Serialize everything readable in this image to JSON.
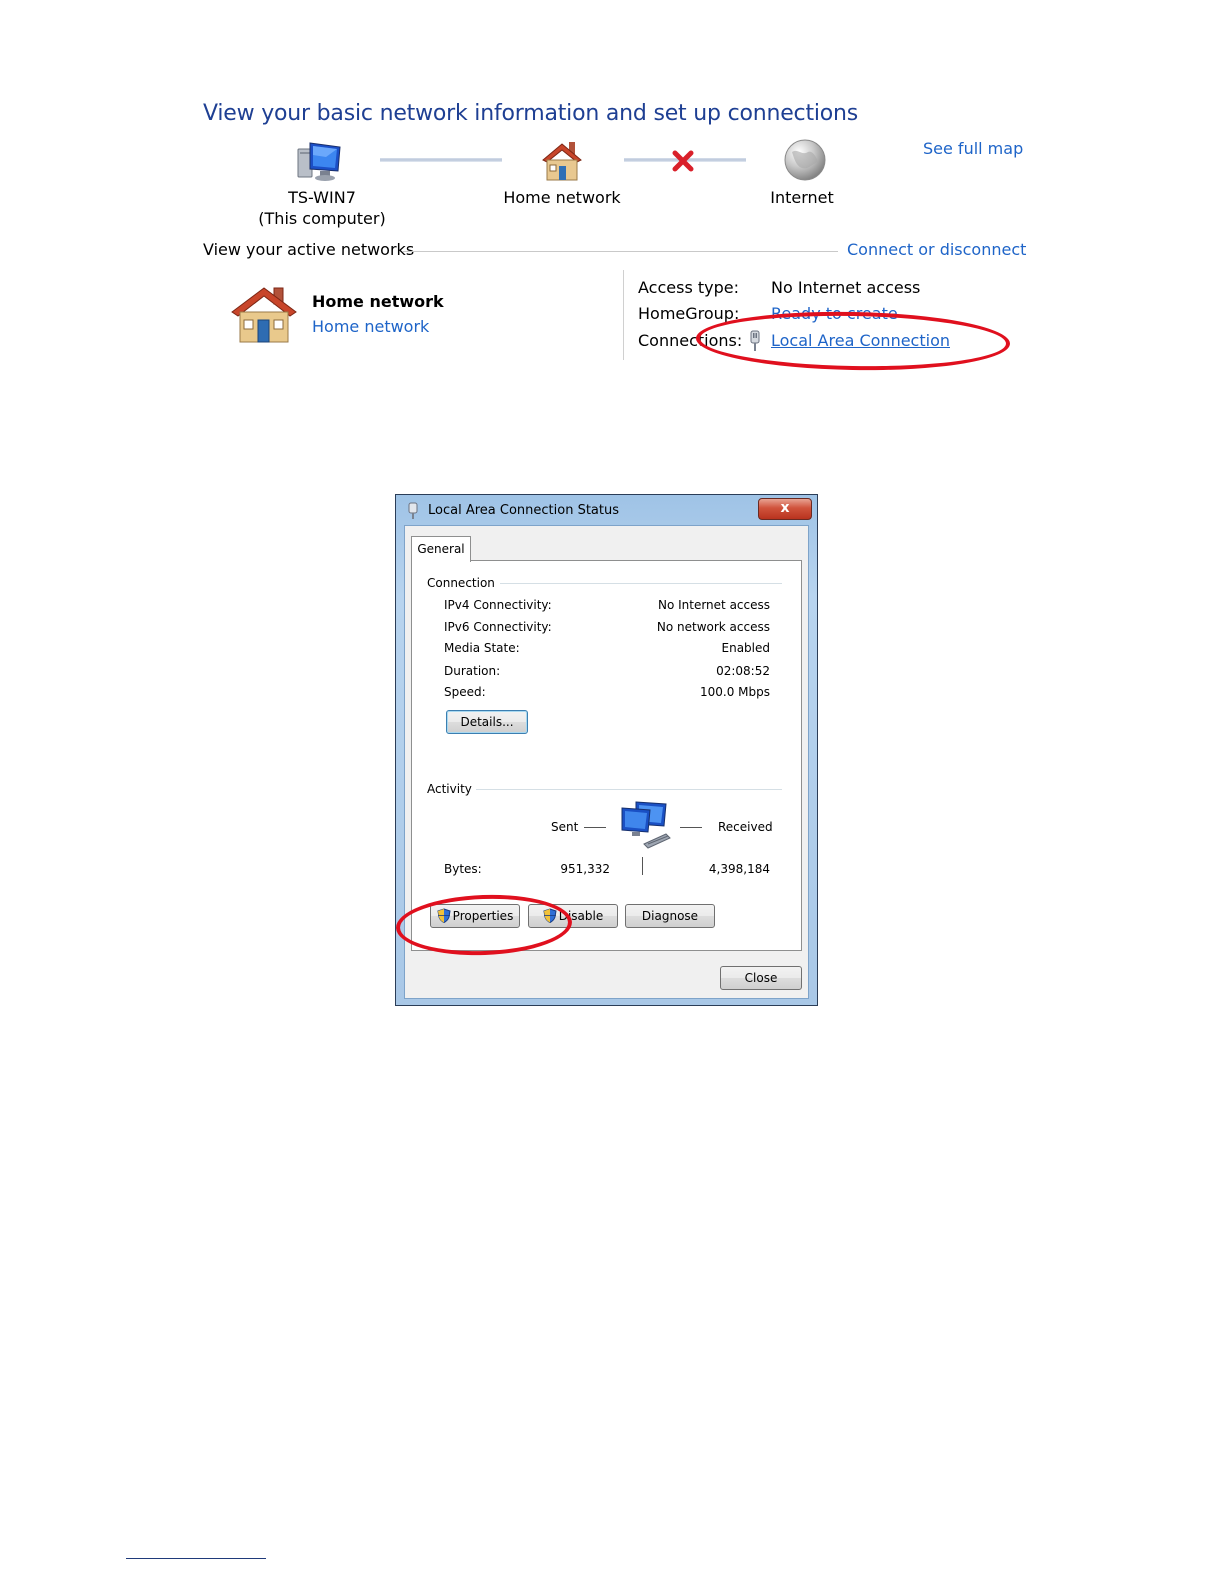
{
  "network_center": {
    "title": "View your basic network information and set up connections",
    "see_full_map": "See full map",
    "nodes": [
      {
        "label": "TS-WIN7",
        "sublabel": "(This computer)",
        "icon": "computer-icon"
      },
      {
        "label": "Home network",
        "icon": "house-icon"
      },
      {
        "label": "Internet",
        "icon": "globe-icon"
      }
    ],
    "active_networks_heading": "View your active networks",
    "connect_or_disconnect": "Connect or disconnect",
    "active_network": {
      "name": "Home network",
      "type": "Home network",
      "access_type_label": "Access type:",
      "access_type_value": "No Internet access",
      "homegroup_label": "HomeGroup:",
      "homegroup_value": "Ready to create",
      "connections_label": "Connections:",
      "connections_value": "Local Area Connection"
    }
  },
  "status_dialog": {
    "title": "Local Area Connection Status",
    "close_glyph": "x",
    "tab": "General",
    "connection_group": "Connection",
    "rows": [
      {
        "label": "IPv4 Connectivity:",
        "value": "No Internet access"
      },
      {
        "label": "IPv6 Connectivity:",
        "value": "No network access"
      },
      {
        "label": "Media State:",
        "value": "Enabled"
      },
      {
        "label": "Duration:",
        "value": "02:08:52"
      },
      {
        "label": "Speed:",
        "value": "100.0 Mbps"
      }
    ],
    "details_button": "Details...",
    "activity_group": "Activity",
    "sent_label": "Sent",
    "received_label": "Received",
    "bytes_label": "Bytes:",
    "bytes_sent": "951,332",
    "bytes_received": "4,398,184",
    "properties_button": "Properties",
    "disable_button": "Disable",
    "diagnose_button": "Diagnose",
    "close_button": "Close"
  },
  "colors": {
    "title_blue": "#1e3f93",
    "link_blue": "#1e64c8",
    "annotation_red": "#e0101e",
    "error_x_red": "#d9202a"
  }
}
